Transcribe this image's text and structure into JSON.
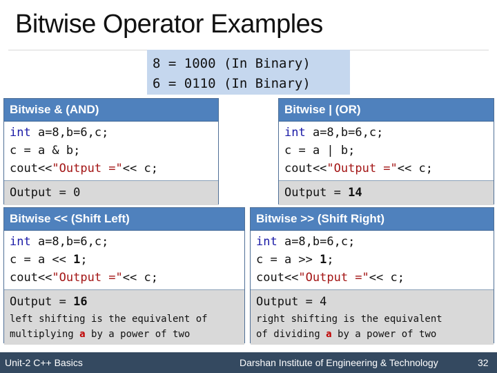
{
  "slide": {
    "title": "Bitwise Operator Examples",
    "binary_lines": [
      "8 = 1000 (In Binary)",
      "6 = 0110 (In Binary)"
    ]
  },
  "boxes": {
    "and": {
      "header": "Bitwise & (AND)",
      "keyword": "int",
      "line1_rest": " a=8,b=6,c;",
      "line2": "c = a & b;",
      "line3_pre": "cout<<",
      "line3_str": "\"Output =\"",
      "line3_post": "<< c;",
      "output_label": "Output = ",
      "output_value": "0"
    },
    "or": {
      "header": "Bitwise | (OR)",
      "keyword": "int",
      "line1_rest": " a=8,b=6,c;",
      "line2": "c = a | b;",
      "line3_pre": "cout<<",
      "line3_str": "\"Output =\"",
      "line3_post": "<< c;",
      "output_label": "Output = ",
      "output_value": "14"
    },
    "shl": {
      "header": "Bitwise << (Shift Left)",
      "keyword": "int",
      "line1_rest": " a=8,b=6,c;",
      "line2_pre": "c = a << ",
      "line2_num": "1",
      "line2_post": ";",
      "line3_pre": "cout<<",
      "line3_str": "\"Output =\"",
      "line3_post": "<< c;",
      "output_label": "Output = ",
      "output_value": "16",
      "note1": "left shifting is the equivalent of",
      "note2_pre": "multiplying ",
      "note2_var": "a",
      "note2_post": " by a power of two"
    },
    "shr": {
      "header": "Bitwise >> (Shift Right)",
      "keyword": "int",
      "line1_rest": " a=8,b=6,c;",
      "line2_pre": "c = a >> ",
      "line2_num": "1",
      "line2_post": ";",
      "line3_pre": "cout<<",
      "line3_str": "\"Output =\"",
      "line3_post": "<< c;",
      "output_label": "Output = ",
      "output_value": "4",
      "note1": "right shifting is the equivalent",
      "note2_pre": "of dividing ",
      "note2_var": "a",
      "note2_post": " by a power of two"
    }
  },
  "footer": {
    "unit": "Unit-2 C++ Basics",
    "institute": "Darshan Institute of Engineering & Technology",
    "page": "32"
  },
  "colors": {
    "header_blue": "#4f81bd",
    "binary_bg": "#c5d7ee",
    "output_gray": "#d9d9d9",
    "footer_bg": "#344960",
    "keyword": "#1a1aa6",
    "string": "#a31515"
  }
}
